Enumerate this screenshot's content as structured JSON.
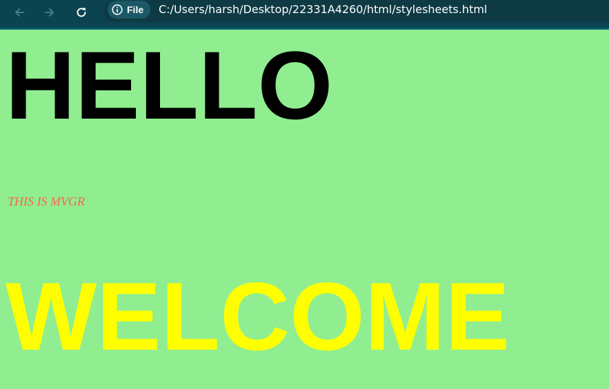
{
  "browser": {
    "chip_label": "File",
    "url": "C:/Users/harsh/Desktop/22331A4260/html/stylesheets.html",
    "icons": {
      "back": "arrow-left-icon",
      "forward": "arrow-right-icon",
      "reload": "reload-icon",
      "info": "info-icon"
    }
  },
  "page": {
    "heading": "HELLO",
    "tagline": "THIS IS MVGR",
    "welcome": "WELCOME",
    "colors": {
      "background": "#90ee90",
      "heading": "#000000",
      "tagline": "#ff6347",
      "welcome": "#ffff00"
    }
  }
}
